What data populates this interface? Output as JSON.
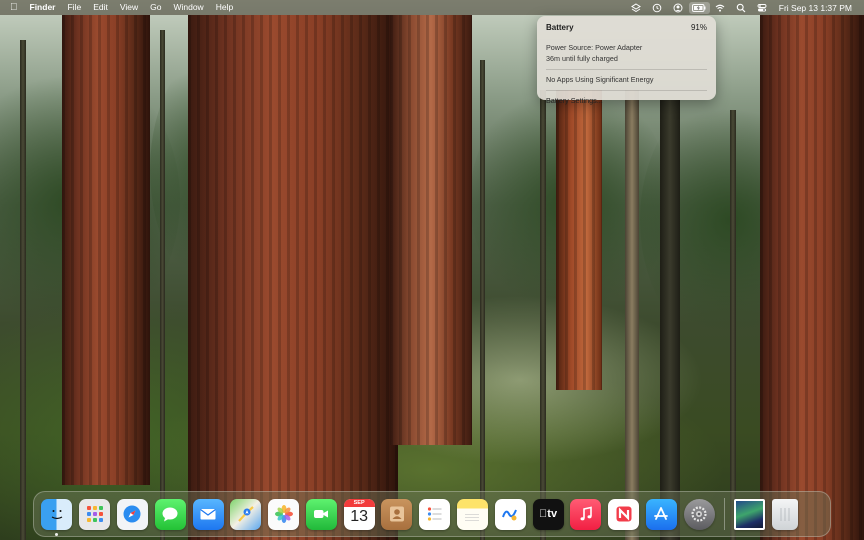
{
  "menubar": {
    "app_name": "Finder",
    "menus": [
      "File",
      "Edit",
      "View",
      "Go",
      "Window",
      "Help"
    ],
    "status_icons": [
      "dropbox-icon",
      "time-machine-icon",
      "user-icon",
      "battery-charging-icon",
      "wifi-icon",
      "spotlight-icon",
      "control-center-icon"
    ],
    "clock": "Fri Sep 13  1:37 PM"
  },
  "battery_popover": {
    "title": "Battery",
    "percent": "91%",
    "power_source": "Power Source: Power Adapter",
    "charge_time": "36m until fully charged",
    "apps_status": "No Apps Using Significant Energy",
    "settings_label": "Battery Settings..."
  },
  "dock": {
    "apps": [
      {
        "name": "Finder",
        "running": true
      },
      {
        "name": "Launchpad",
        "running": false
      },
      {
        "name": "Safari",
        "running": false
      },
      {
        "name": "Messages",
        "running": false
      },
      {
        "name": "Mail",
        "running": false
      },
      {
        "name": "Maps",
        "running": false
      },
      {
        "name": "Photos",
        "running": false
      },
      {
        "name": "FaceTime",
        "running": false
      },
      {
        "name": "Calendar",
        "running": false
      },
      {
        "name": "Contacts",
        "running": false
      },
      {
        "name": "Reminders",
        "running": false
      },
      {
        "name": "Notes",
        "running": false
      },
      {
        "name": "Freeform",
        "running": false
      },
      {
        "name": "TV",
        "running": false
      },
      {
        "name": "Music",
        "running": false
      },
      {
        "name": "News",
        "running": false
      },
      {
        "name": "App Store",
        "running": false
      },
      {
        "name": "System Settings",
        "running": false
      }
    ],
    "calendar_month": "SEP",
    "calendar_day": "13",
    "tv_label": "tv"
  }
}
